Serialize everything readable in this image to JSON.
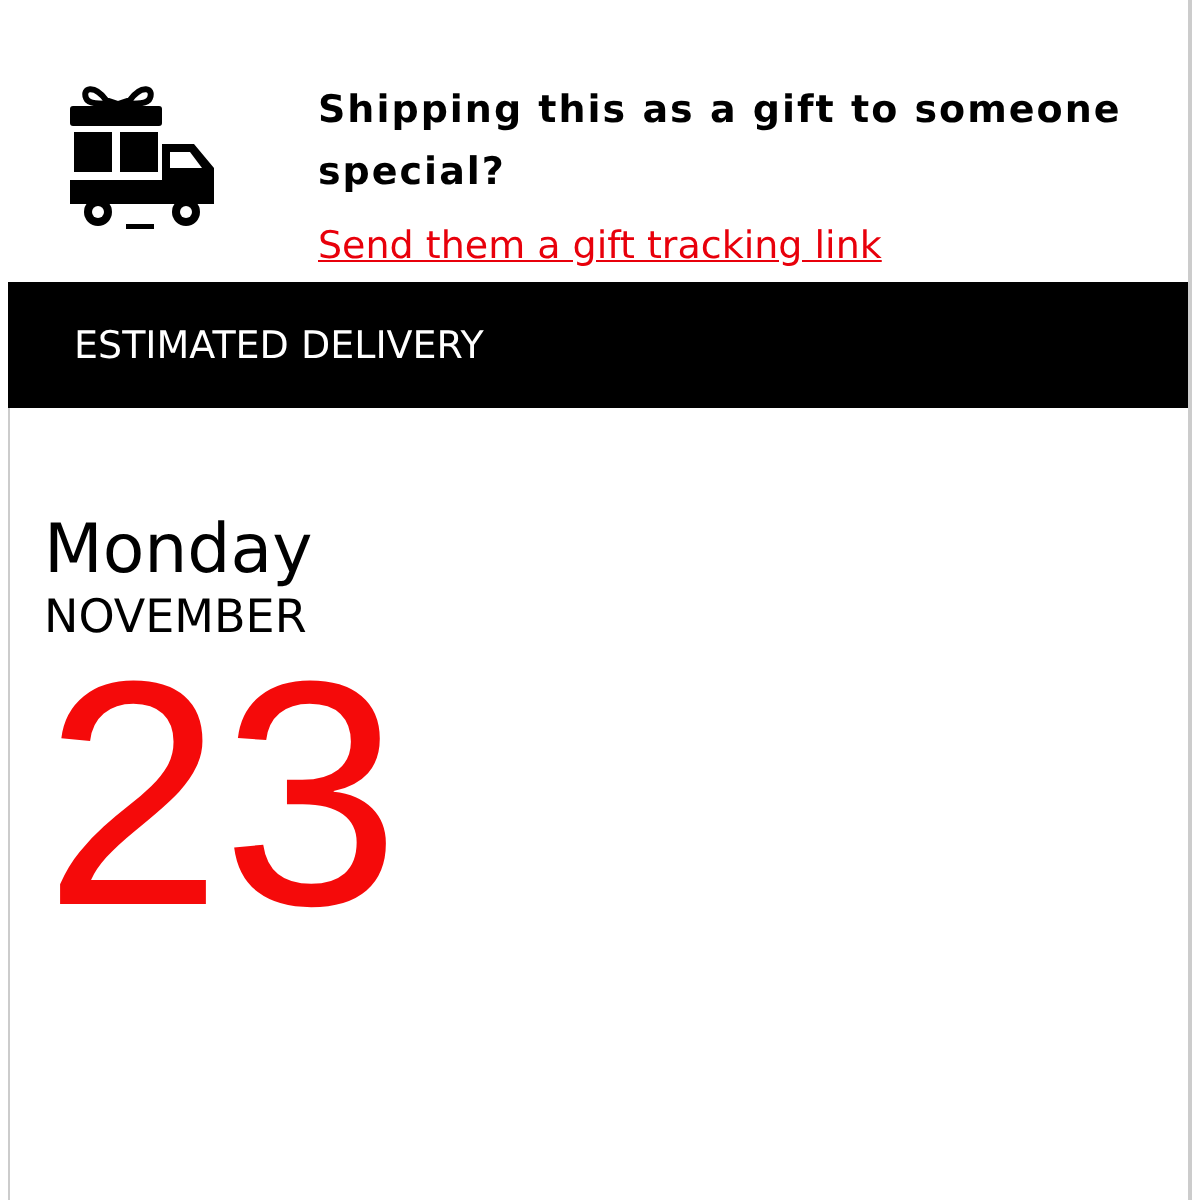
{
  "gift_banner": {
    "message": "Shipping this as a gift to someone special?",
    "link": "Send them a gift tracking link"
  },
  "delivery": {
    "heading": "ESTIMATED DELIVERY",
    "weekday": "Monday",
    "month": "NOVEMBER",
    "day": "23"
  }
}
